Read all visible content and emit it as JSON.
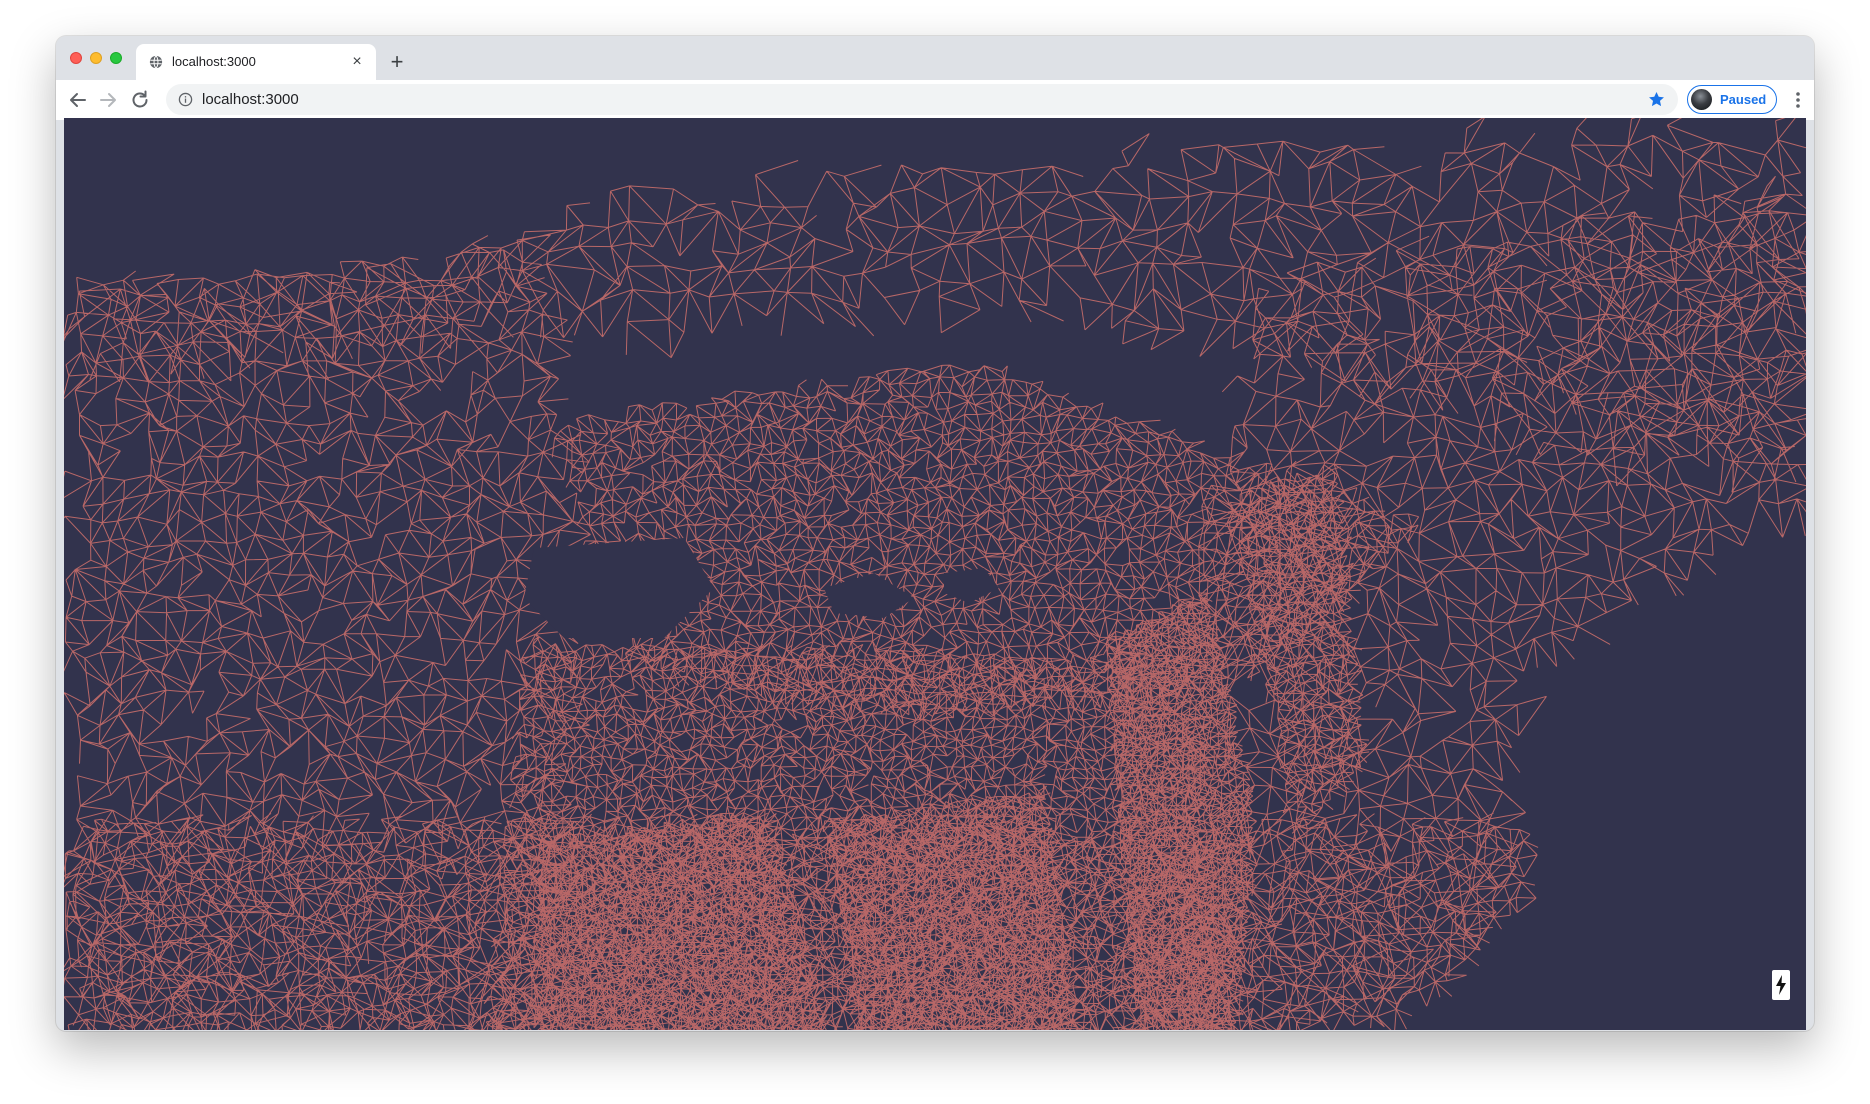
{
  "browser": {
    "tab": {
      "title": "localhost:3000",
      "favicon": "globe-icon",
      "close": "×"
    },
    "new_tab": "+",
    "toolbar": {
      "back_icon": "back-arrow-icon",
      "forward_icon": "forward-arrow-icon",
      "reload_icon": "reload-icon",
      "url": "localhost:3000",
      "info_icon": "info-icon",
      "bookmark_icon": "star-icon",
      "profile_status": "Paused",
      "menu_icon": "kebab-menu-icon"
    }
  },
  "viewport": {
    "background": "#32334d",
    "mesh_color": "#c06a68",
    "stats_button_icon": "lightning-bolt-icon"
  }
}
